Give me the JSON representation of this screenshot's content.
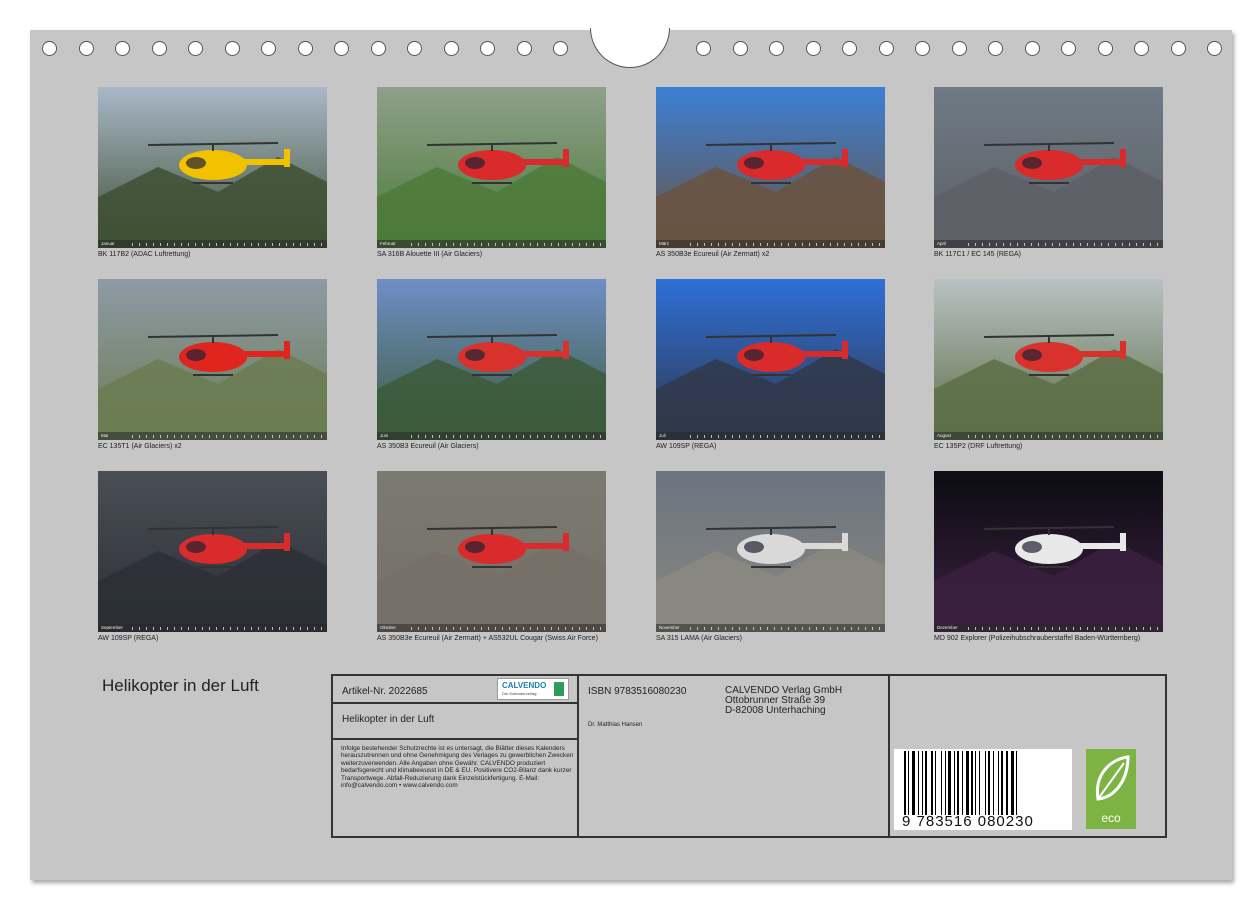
{
  "calendar_title": "Helikopter in der Luft",
  "photos": [
    {
      "month": "Januar",
      "caption": "BK 117B2 (ADAC Luftrettung)"
    },
    {
      "month": "Februar",
      "caption": "SA 316B Alouette III (Air Glaciers)"
    },
    {
      "month": "März",
      "caption": "AS 350B3e Ecureuil (Air Zermatt) x2"
    },
    {
      "month": "April",
      "caption": "BK 117C1 / EC 145 (REGA)"
    },
    {
      "month": "Mai",
      "caption": "EC 135T1 (Air Glaciers) x2"
    },
    {
      "month": "Juni",
      "caption": "AS 350B3 Ecureuil (Air Glaciers)"
    },
    {
      "month": "Juli",
      "caption": "AW 109SP (REGA)"
    },
    {
      "month": "August",
      "caption": "EC 135P2 (DRF Luftrettung)"
    },
    {
      "month": "September",
      "caption": "AW 109SP (REGA)"
    },
    {
      "month": "Oktober",
      "caption": "AS 350B3e Ecureuil (Air Zermatt) + AS532UL Cougar (Swiss Air Force)"
    },
    {
      "month": "November",
      "caption": "SA 315 LAMA (Air Glaciers)"
    },
    {
      "month": "Dezember",
      "caption": "MD 902 Explorer (Polizeihubschrauberstaffel Baden-Württemberg)"
    }
  ],
  "info": {
    "article": "Artikel-Nr. 2022685",
    "title": "Helikopter in der Luft",
    "legal": "Infolge bestehender Schutzrechte ist es untersagt, die Blätter dieses Kalenders herauszutrennen und ohne Genehmigung des Verlages zu gewerblichen Zwecken weiterzuverwenden. Alle Angaben ohne Gewähr. CALVENDO produziert bedarfsgerecht und klimabewusst in DE & EU. Positivere CO2-Bilanz dank kurzer Transportwege. Abfall-Reduzierung dank Einzelstückfertigung. E-Mail: info@calvendo.com • www.calvendo.com",
    "isbn": "ISBN 9783516080230",
    "author": "Dr. Matthias Hansen",
    "publisher_name": "CALVENDO Verlag GmbH",
    "publisher_street": "Ottobrunner Straße 39",
    "publisher_city": "D-82008 Unterhaching",
    "calvendo_logo": "CALVENDO",
    "calvendo_tagline": "Der Kalenderverlag",
    "barcode_number": "9  783516  080230",
    "eco_label": "eco"
  }
}
